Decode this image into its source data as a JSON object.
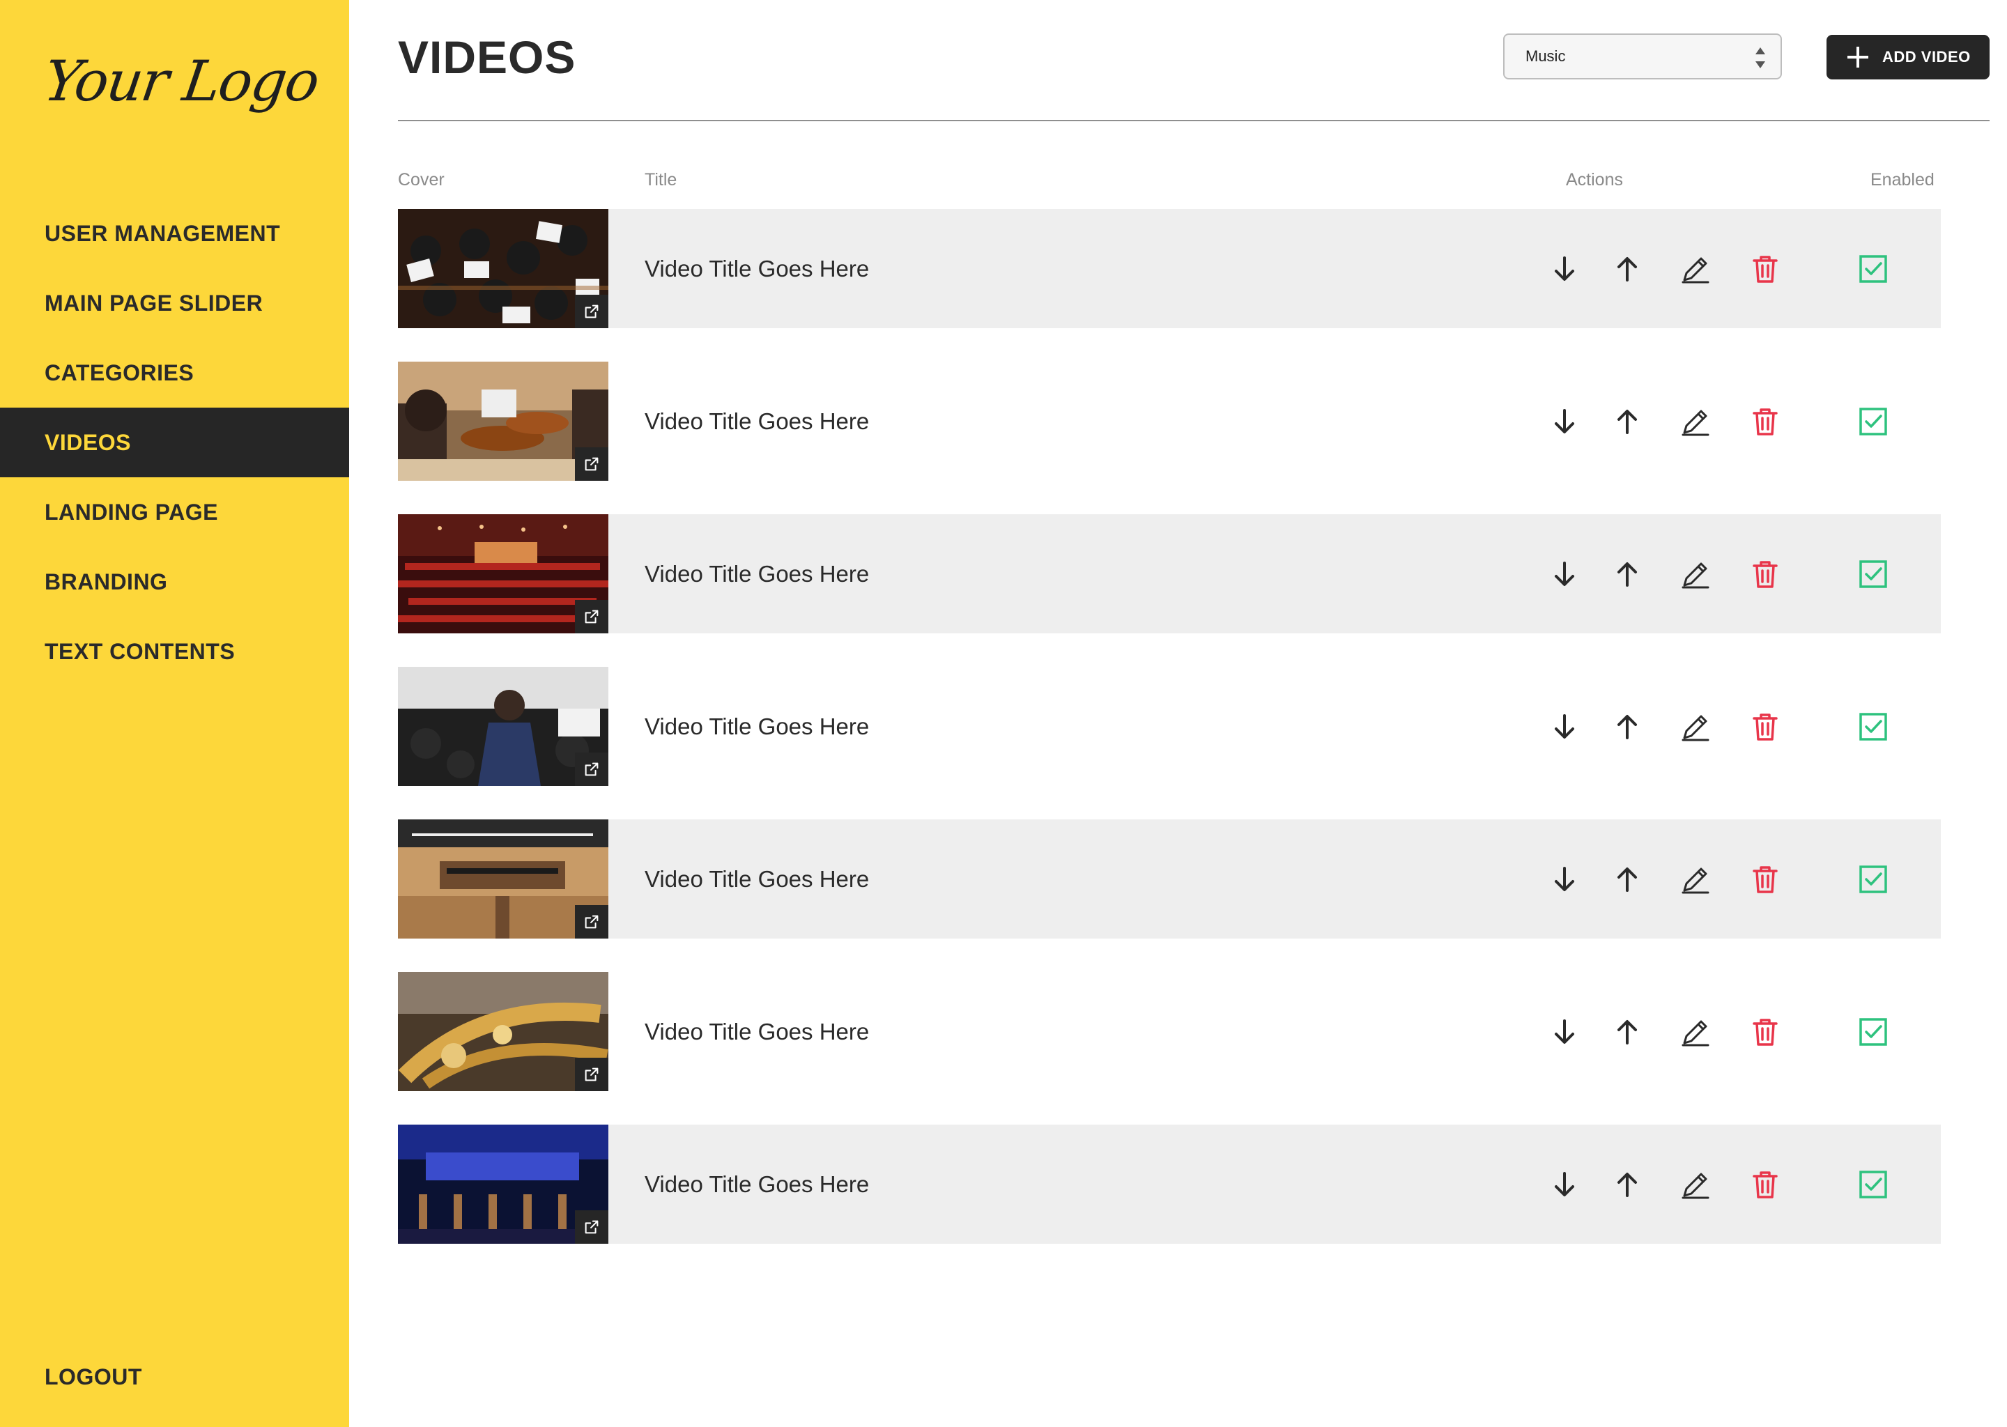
{
  "brand": {
    "logo_text": "Your Logo",
    "accent": "#fdd73a",
    "dark": "#262626",
    "danger": "#e8354a",
    "success": "#2ec27e"
  },
  "sidebar": {
    "items": [
      {
        "label": "USER MANAGEMENT",
        "active": false
      },
      {
        "label": "MAIN PAGE SLIDER",
        "active": false
      },
      {
        "label": "CATEGORIES",
        "active": false
      },
      {
        "label": "VIDEOS",
        "active": true
      },
      {
        "label": "LANDING PAGE",
        "active": false
      },
      {
        "label": "BRANDING",
        "active": false
      },
      {
        "label": "TEXT CONTENTS",
        "active": false
      }
    ],
    "logout_label": "LOGOUT"
  },
  "header": {
    "title": "VIDEOS",
    "category_select": {
      "value": "Music"
    },
    "add_button_label": "ADD VIDEO"
  },
  "table": {
    "columns": {
      "cover": "Cover",
      "title": "Title",
      "actions": "Actions",
      "enabled": "Enabled"
    },
    "rows": [
      {
        "title": "Video Title Goes Here",
        "enabled": true,
        "cover_scene": "orchestra-from-above"
      },
      {
        "title": "Video Title Goes Here",
        "enabled": true,
        "cover_scene": "violinists"
      },
      {
        "title": "Video Title Goes Here",
        "enabled": true,
        "cover_scene": "red-concert-hall"
      },
      {
        "title": "Video Title Goes Here",
        "enabled": true,
        "cover_scene": "singer-on-stage"
      },
      {
        "title": "Video Title Goes Here",
        "enabled": true,
        "cover_scene": "wide-concert-hall"
      },
      {
        "title": "Video Title Goes Here",
        "enabled": true,
        "cover_scene": "brass-instrument"
      },
      {
        "title": "Video Title Goes Here",
        "enabled": true,
        "cover_scene": "blue-lit-stage"
      }
    ],
    "row_actions": [
      "move-down-icon",
      "move-up-icon",
      "edit-icon",
      "delete-icon"
    ]
  }
}
